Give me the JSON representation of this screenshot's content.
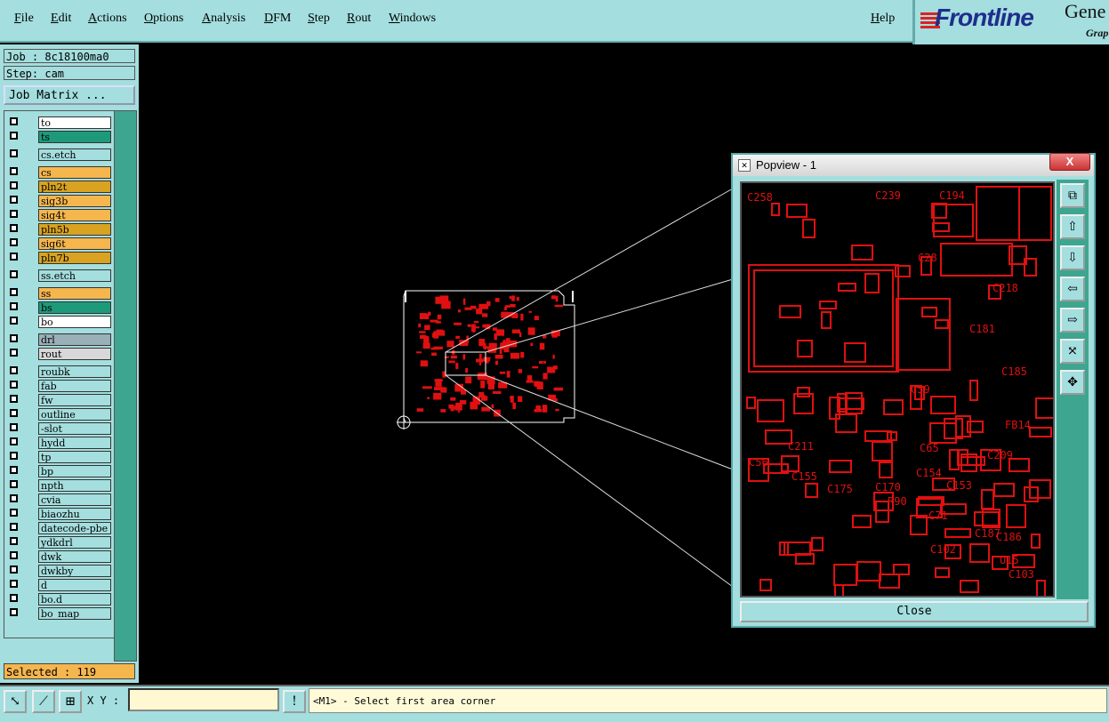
{
  "menu": {
    "items": [
      "File",
      "Edit",
      "Actions",
      "Options",
      "Analysis",
      "DFM",
      "Step",
      "Rout",
      "Windows"
    ],
    "help": "Help"
  },
  "logo": {
    "brand": "Frontline",
    "product": "Gene",
    "sub": "Grap"
  },
  "job": {
    "label": "Job : 8c18100ma0",
    "step": "Step: cam",
    "matrix_button": "Job Matrix ..."
  },
  "layers": [
    {
      "name": "to",
      "color": "#ffffff"
    },
    {
      "name": "ts",
      "color": "#1e9a7a"
    },
    {
      "name": "cs.etch",
      "color": "#a4dede"
    },
    {
      "name": "cs",
      "color": "#f6b64e"
    },
    {
      "name": "pln2t",
      "color": "#d9a321"
    },
    {
      "name": "sig3b",
      "color": "#f6b64e"
    },
    {
      "name": "sig4t",
      "color": "#f6b64e"
    },
    {
      "name": "pln5b",
      "color": "#d9a321"
    },
    {
      "name": "sig6t",
      "color": "#f6b64e"
    },
    {
      "name": "pln7b",
      "color": "#d9a321"
    },
    {
      "name": "ss.etch",
      "color": "#a4dede"
    },
    {
      "name": "ss",
      "color": "#f6b64e"
    },
    {
      "name": "bs",
      "color": "#1e9a7a"
    },
    {
      "name": "bo",
      "color": "#ffffff"
    },
    {
      "name": "drl",
      "color": "#9ab0b8"
    },
    {
      "name": "rout",
      "color": "#d8d8d8"
    },
    {
      "name": "roubk",
      "color": "#a4dede"
    },
    {
      "name": "fab",
      "color": "#a4dede"
    },
    {
      "name": "fw",
      "color": "#a4dede"
    },
    {
      "name": "outline",
      "color": "#a4dede"
    },
    {
      "name": "-slot",
      "color": "#a4dede"
    },
    {
      "name": "hydd",
      "color": "#a4dede"
    },
    {
      "name": "tp",
      "color": "#a4dede"
    },
    {
      "name": "bp",
      "color": "#a4dede"
    },
    {
      "name": "npth",
      "color": "#a4dede"
    },
    {
      "name": "cvia",
      "color": "#a4dede"
    },
    {
      "name": "biaozhu",
      "color": "#a4dede"
    },
    {
      "name": "datecode-pbe",
      "color": "#a4dede"
    },
    {
      "name": "ydkdrl",
      "color": "#a4dede"
    },
    {
      "name": "dwk",
      "color": "#a4dede"
    },
    {
      "name": "dwkby",
      "color": "#a4dede"
    },
    {
      "name": "d",
      "color": "#a4dede"
    },
    {
      "name": "bo.d",
      "color": "#a4dede"
    },
    {
      "name": "bo_map",
      "color": "#a4dede"
    }
  ],
  "selected": "Selected : 119",
  "xy": {
    "label": "X Y :",
    "value": ""
  },
  "prompt": "<M1> - Select first area corner",
  "popview": {
    "title": "Popview - 1",
    "close": "Close",
    "close_x": "X"
  },
  "colors": {
    "panel": "#a4dede",
    "accent": "#3ea690",
    "pcb": "#e01010",
    "bg": "#000000"
  },
  "pcb_labels": [
    "C258",
    "C239",
    "C194",
    "C28",
    "C218",
    "C59",
    "C185",
    "C181",
    "FB14",
    "C211",
    "C175",
    "C65",
    "C209",
    "R90",
    "C71",
    "C187",
    "C186",
    "C102",
    "U15",
    "C103",
    "C153",
    "C155",
    "C154",
    "C170",
    "C56"
  ]
}
